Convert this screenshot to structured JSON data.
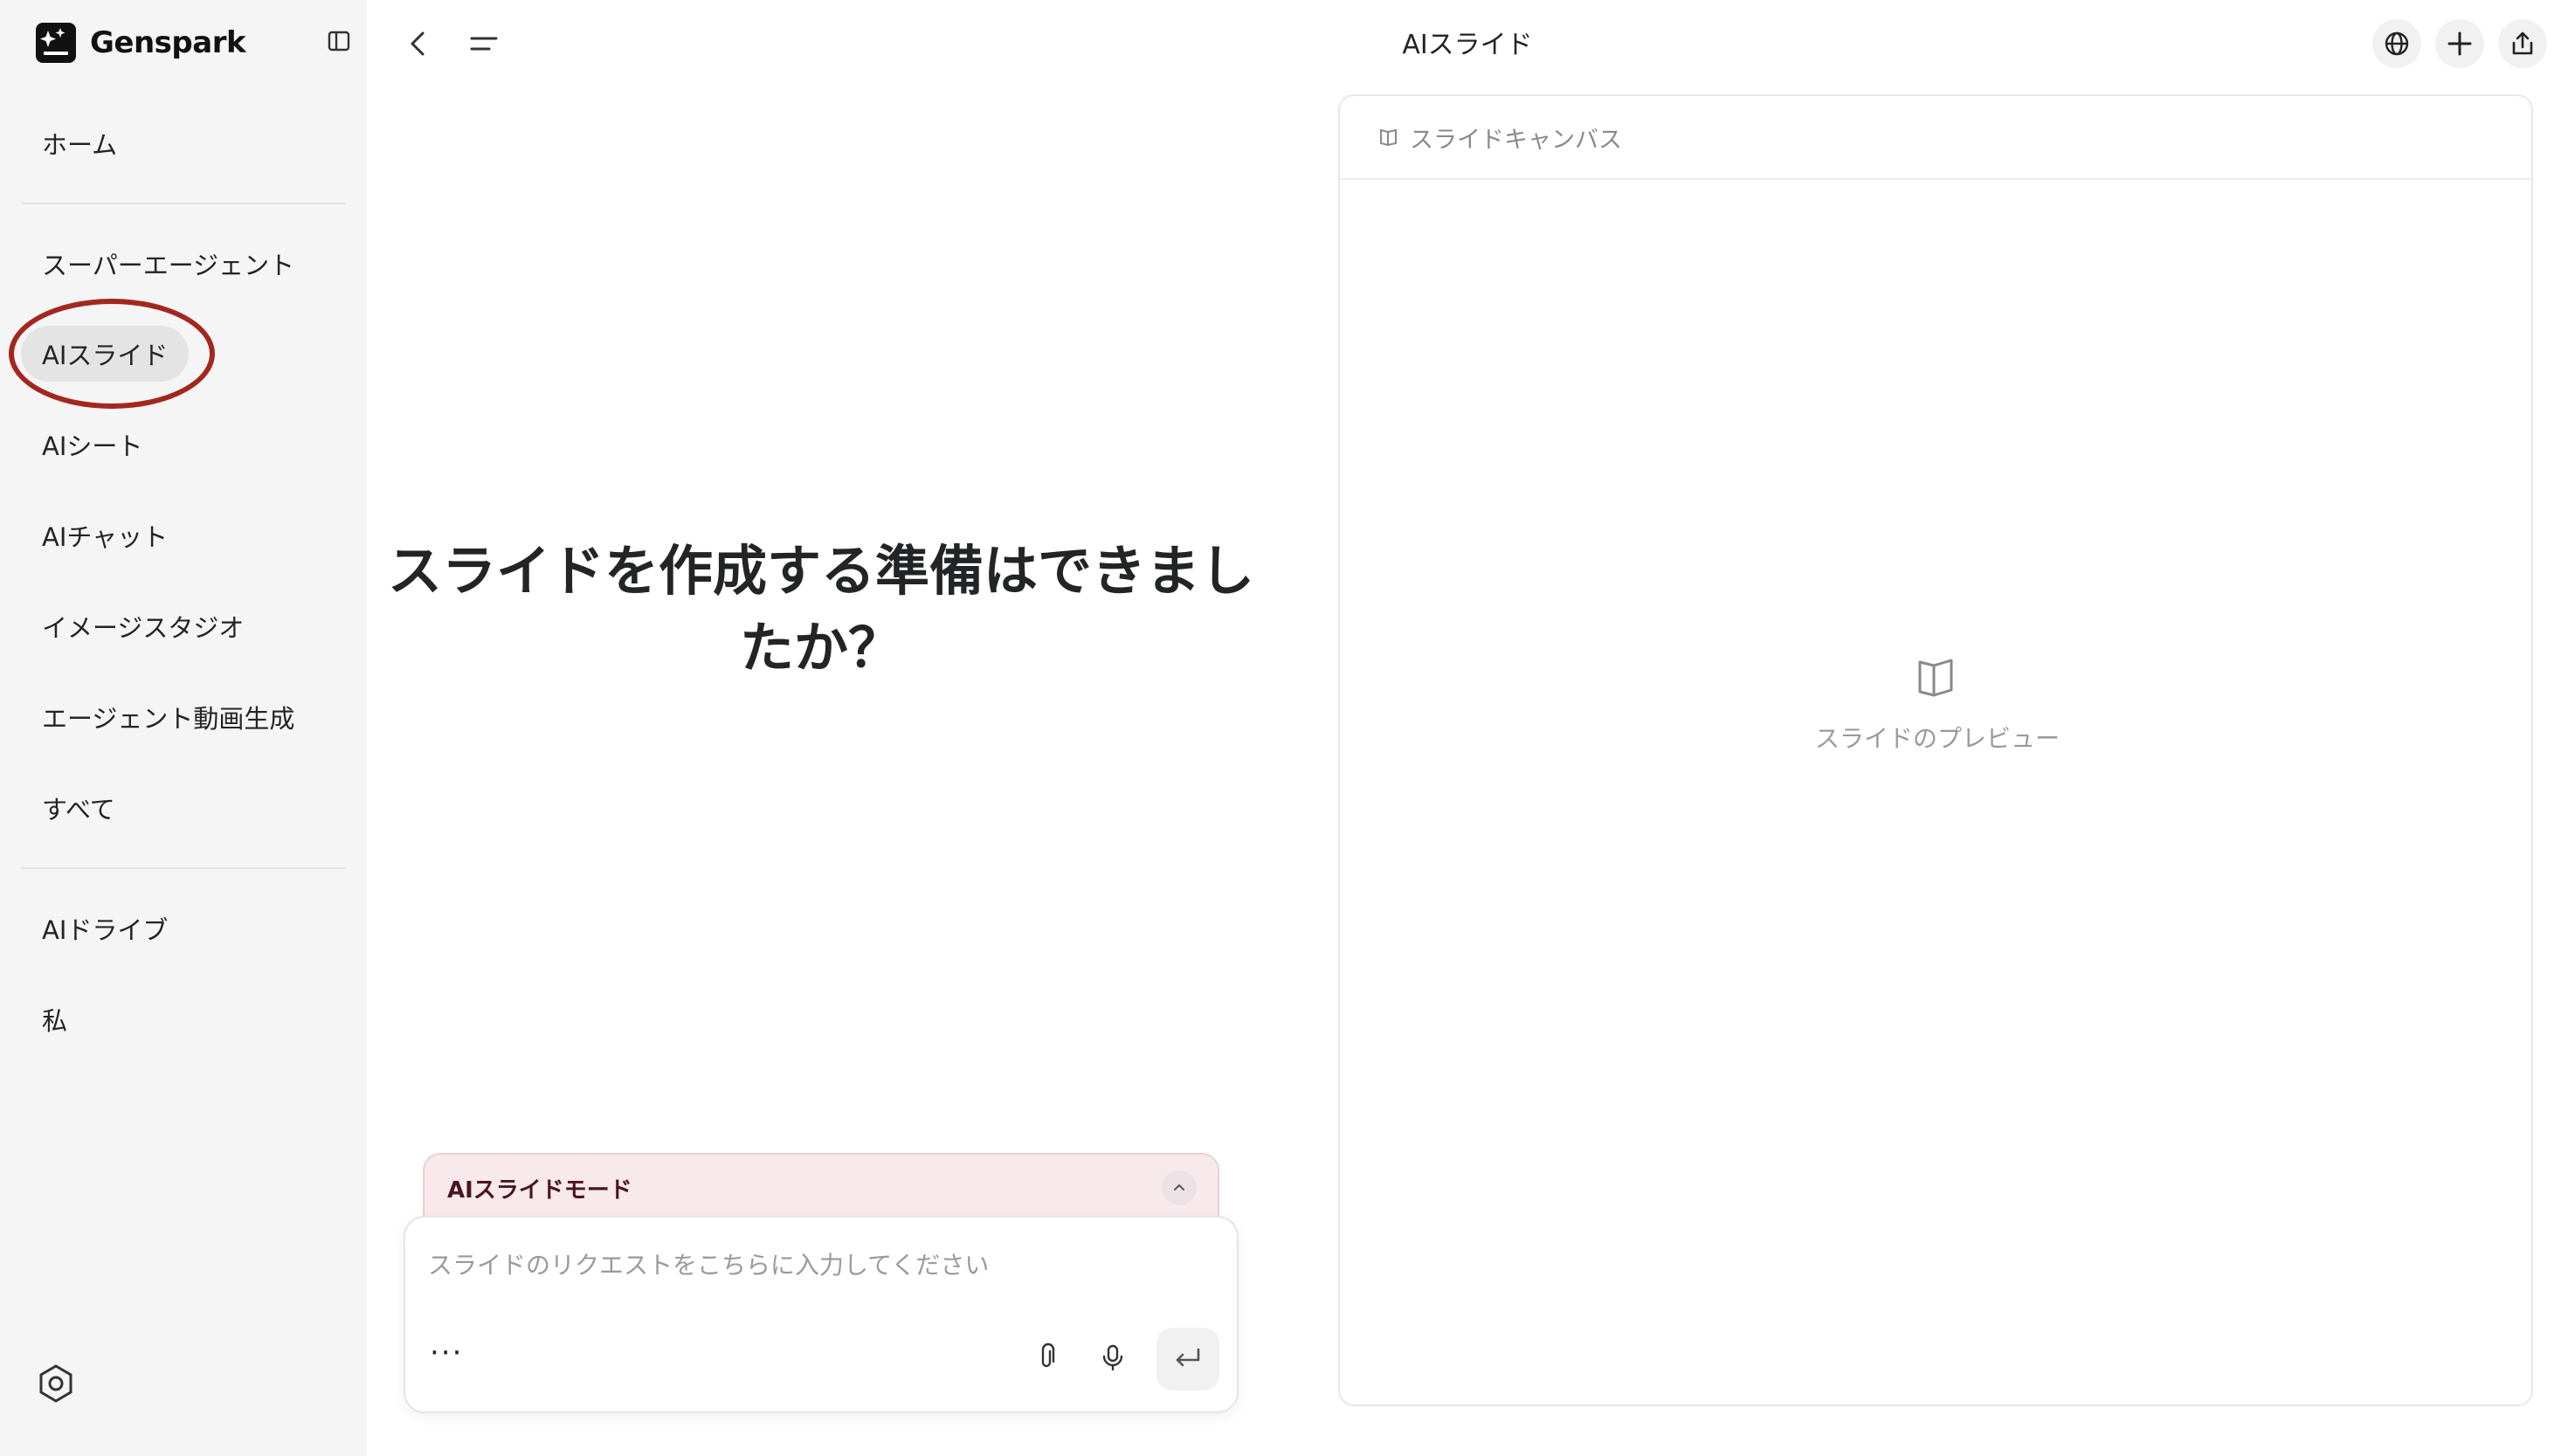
{
  "app": {
    "name": "Genspark"
  },
  "sidebar": {
    "items": [
      {
        "label": "ホーム"
      },
      {
        "label": "スーパーエージェント"
      },
      {
        "label": "AIスライド",
        "active": true
      },
      {
        "label": "AIシート"
      },
      {
        "label": "AIチャット"
      },
      {
        "label": "イメージスタジオ"
      },
      {
        "label": "エージェント動画生成"
      },
      {
        "label": "すべて"
      },
      {
        "label": "AIドライブ"
      },
      {
        "label": "私"
      }
    ]
  },
  "header": {
    "title": "AIスライド"
  },
  "main": {
    "heading_line1": "スライドを作成する準備はできまし",
    "heading_line2": "たか？",
    "mode_label": "AIスライドモード",
    "input_placeholder": "スライドのリクエストをこちらに入力してください",
    "more_label": "···"
  },
  "canvas": {
    "header_label": "スライドキャンバス",
    "preview_label": "スライドのプレビュー"
  },
  "colors": {
    "sidebar_bg": "#f5f5f5",
    "active_item_bg": "#e4e4e4",
    "highlight_ring": "#a3271f",
    "mode_bar_bg": "#f7e9ec"
  },
  "icons": [
    "genspark-logo-icon",
    "sidebar-collapse-icon",
    "back-icon",
    "menu-icon",
    "globe-icon",
    "plus-icon",
    "share-icon",
    "settings-icon",
    "chevron-up-icon",
    "paperclip-icon",
    "microphone-icon",
    "enter-icon",
    "book-icon"
  ]
}
